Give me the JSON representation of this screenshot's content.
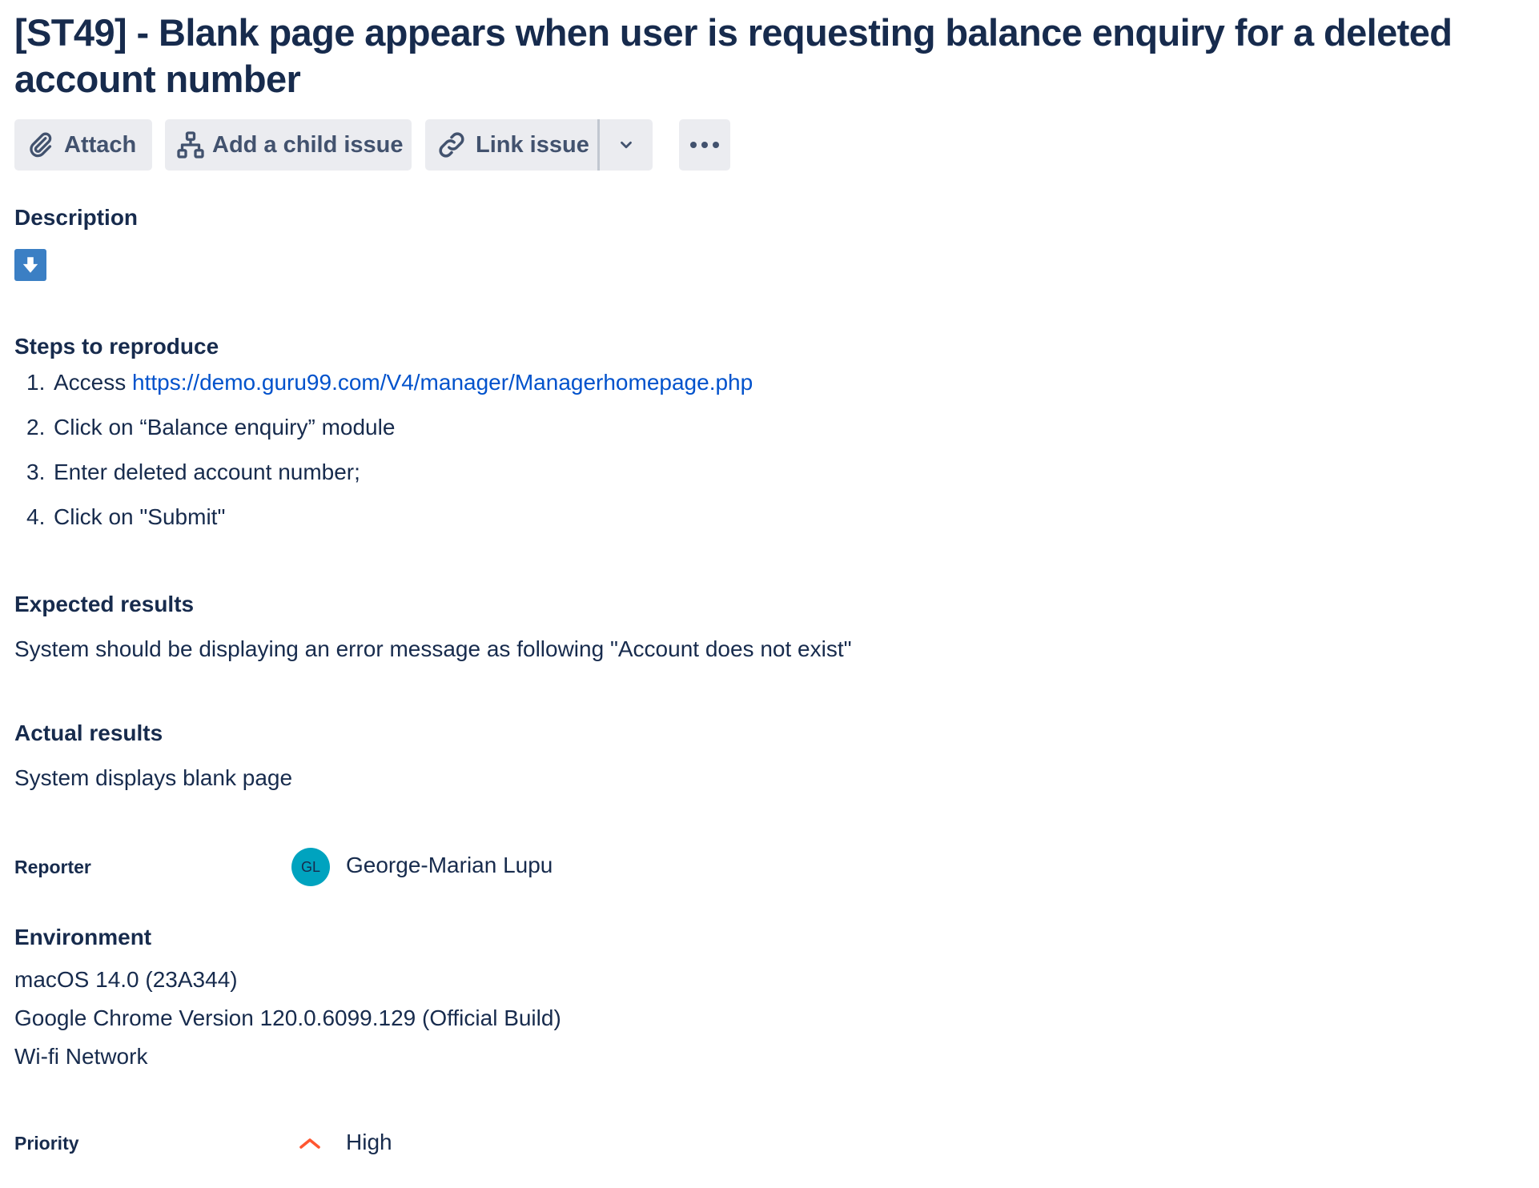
{
  "issue": {
    "title": "[ST49] - Blank page appears when user is requesting balance enquiry for a deleted account number"
  },
  "toolbar": {
    "attach_label": "Attach",
    "attach_icon": "paperclip-icon",
    "add_child_label": "Add a child issue",
    "add_child_icon": "hierarchy-icon",
    "link_issue_label": "Link issue",
    "link_issue_icon": "link-icon",
    "dropdown_icon": "chevron-down-icon",
    "more_icon": "more-horizontal-icon",
    "more_label": "•••"
  },
  "description": {
    "heading": "Description",
    "download_icon": "download-arrow-icon",
    "download_icon_color": "#3b7fc4",
    "steps_heading": "Steps to reproduce",
    "steps": [
      {
        "number": "1.",
        "text": "Access ",
        "link": "https://demo.guru99.com/V4/manager/Managerhomepage.php"
      },
      {
        "number": "2.",
        "text": "Click on “Balance enquiry” module"
      },
      {
        "number": "3.",
        "text": "Enter deleted account number;"
      },
      {
        "number": "4.",
        "text": "Click on \"Submit\""
      }
    ],
    "expected_heading": "Expected results",
    "expected_text": "System should be displaying an error message as following \"Account does not exist\"",
    "actual_heading": "Actual results",
    "actual_text": "System displays blank page"
  },
  "reporter": {
    "label": "Reporter",
    "initials": "GL",
    "name": "George-Marian Lupu",
    "avatar_color": "#00a3bf"
  },
  "environment": {
    "heading": "Environment",
    "lines": [
      "macOS 14.0 (23A344)",
      "Google Chrome Version 120.0.6099.129 (Official Build)",
      "Wi-fi Network"
    ]
  },
  "priority": {
    "label": "Priority",
    "value": "High",
    "icon": "priority-high-icon",
    "icon_color": "#ff5630"
  },
  "colors": {
    "text": "#172b4d",
    "link": "#0052cc",
    "button_bg": "#ebecf0"
  }
}
